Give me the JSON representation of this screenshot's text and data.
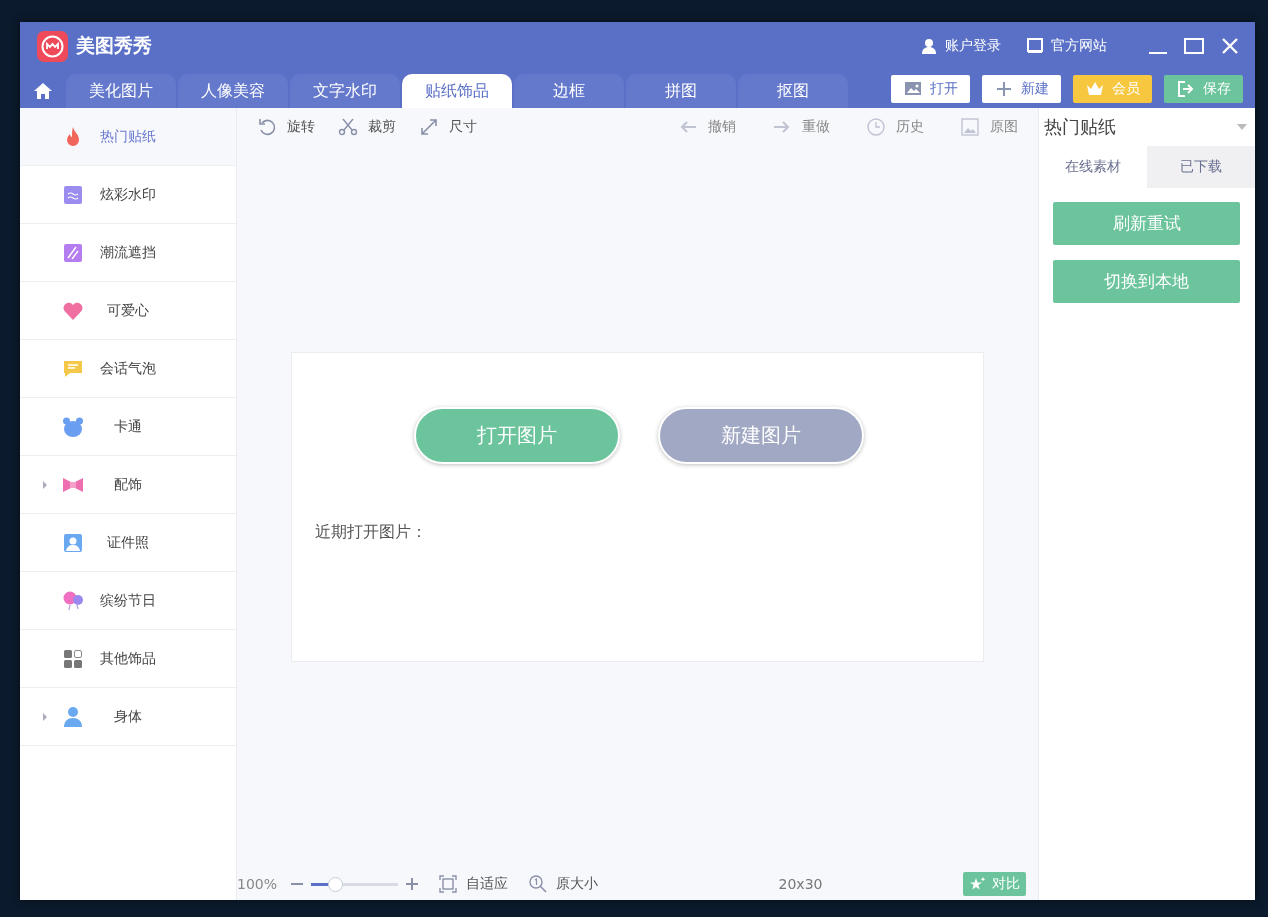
{
  "app": {
    "title": "美图秀秀"
  },
  "title_bar": {
    "links": [
      {
        "label": "账户登录"
      },
      {
        "label": "官方网站"
      }
    ]
  },
  "tabs": [
    {
      "label": "美化图片",
      "selected": false
    },
    {
      "label": "人像美容",
      "selected": false
    },
    {
      "label": "文字水印",
      "selected": false
    },
    {
      "label": "贴纸饰品",
      "selected": true
    },
    {
      "label": "边框",
      "selected": false
    },
    {
      "label": "拼图",
      "selected": false
    },
    {
      "label": "抠图",
      "selected": false
    }
  ],
  "actions": [
    {
      "label": "打开",
      "kind": "open"
    },
    {
      "label": "新建",
      "kind": "new"
    },
    {
      "label": "会员",
      "kind": "vip"
    },
    {
      "label": "保存",
      "kind": "save"
    }
  ],
  "sidebar": {
    "items": [
      {
        "label": "热门贴纸",
        "selected": true,
        "expandable": false
      },
      {
        "label": "炫彩水印",
        "selected": false,
        "expandable": false
      },
      {
        "label": "潮流遮挡",
        "selected": false,
        "expandable": false
      },
      {
        "label": "可爱心",
        "selected": false,
        "expandable": false
      },
      {
        "label": "会话气泡",
        "selected": false,
        "expandable": false
      },
      {
        "label": "卡通",
        "selected": false,
        "expandable": false
      },
      {
        "label": "配饰",
        "selected": false,
        "expandable": true
      },
      {
        "label": "证件照",
        "selected": false,
        "expandable": false
      },
      {
        "label": "缤纷节日",
        "selected": false,
        "expandable": false
      },
      {
        "label": "其他饰品",
        "selected": false,
        "expandable": false
      },
      {
        "label": "身体",
        "selected": false,
        "expandable": true
      }
    ]
  },
  "toolbar": {
    "left": [
      {
        "label": "旋转",
        "disabled": false
      },
      {
        "label": "裁剪",
        "disabled": false
      },
      {
        "label": "尺寸",
        "disabled": false
      }
    ],
    "right": [
      {
        "label": "撤销",
        "disabled": true
      },
      {
        "label": "重做",
        "disabled": true
      },
      {
        "label": "历史",
        "disabled": true
      },
      {
        "label": "原图",
        "disabled": true
      }
    ]
  },
  "start_card": {
    "buttons": [
      {
        "label": "打开图片",
        "kind": "primary"
      },
      {
        "label": "新建图片",
        "kind": "secondary"
      }
    ],
    "recent_label": "近期打开图片："
  },
  "status_bar": {
    "zoom": "100%",
    "zoom_slider": {
      "level": 0.29
    },
    "fit": "自适应",
    "actual_size": "原大小",
    "dimensions": "20x30",
    "compare": "对比"
  },
  "right_panel": {
    "category": "热门贴纸",
    "tabs": [
      {
        "label": "在线素材",
        "selected": true
      },
      {
        "label": "已下载",
        "selected": false
      }
    ],
    "buttons": [
      "刷新重试",
      "切换到本地"
    ]
  }
}
